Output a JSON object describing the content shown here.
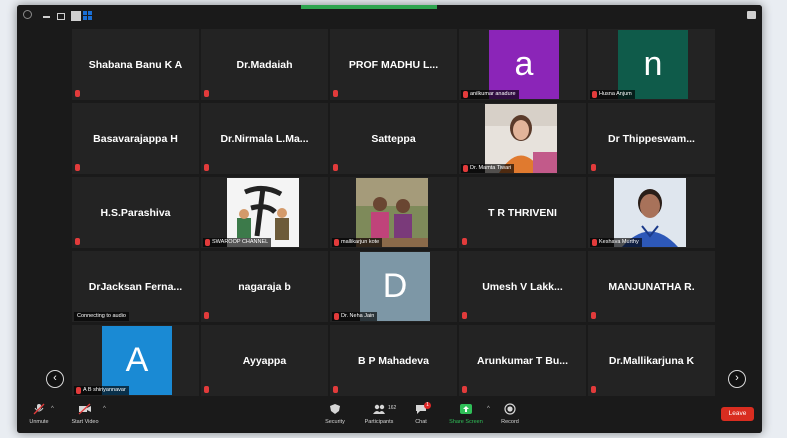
{
  "colors": {
    "window_bg": "#1a1a1a",
    "tile_bg": "#232323",
    "mic_muted": "#e23b3b",
    "active_speaker": "#2ea44f",
    "share_screen": "#2fbf58",
    "leave": "#d92d20",
    "avatar_a_purple": "#8b25b8",
    "avatar_n_green": "#0f5b4a",
    "avatar_D_grey": "#7d97a6",
    "avatar_A_blue": "#1a8ad4"
  },
  "tiles": [
    {
      "name": "Shabana Banu K A",
      "kind": "name"
    },
    {
      "name": "Dr.Madaiah",
      "kind": "name"
    },
    {
      "name": "PROF MADHU L...",
      "kind": "name"
    },
    {
      "name": "anilkumar anadure",
      "kind": "avatar",
      "letter": "a"
    },
    {
      "name": "Husna Anjum",
      "kind": "avatar",
      "letter": "n"
    },
    {
      "name": "Basavarajappa H",
      "kind": "name"
    },
    {
      "name": "Dr.Nirmala L.Ma...",
      "kind": "name"
    },
    {
      "name": "Satteppa",
      "kind": "name"
    },
    {
      "name": "Dr. Mamta Tiwari",
      "kind": "photo"
    },
    {
      "name": "Dr Thippeswam...",
      "kind": "name"
    },
    {
      "name": "H.S.Parashiva",
      "kind": "name"
    },
    {
      "name": "SWAROOP CHANNEL",
      "kind": "photo"
    },
    {
      "name": "mallikarjun kote",
      "kind": "photo"
    },
    {
      "name": "T R THRIVENI",
      "kind": "name"
    },
    {
      "name": "Keshava Murthy",
      "kind": "photo"
    },
    {
      "name": "DrJacksan Ferna...",
      "kind": "name",
      "status": "Connecting to audio"
    },
    {
      "name": "nagaraja b",
      "kind": "name"
    },
    {
      "name": "Dr. Neha Jain",
      "kind": "avatar",
      "letter": "D"
    },
    {
      "name": "Umesh V Lakk...",
      "kind": "name"
    },
    {
      "name": "MANJUNATHA R.",
      "kind": "name"
    },
    {
      "name": "A B shiriyannavar",
      "kind": "avatar",
      "letter": "A"
    },
    {
      "name": "Ayyappa",
      "kind": "name"
    },
    {
      "name": "B P Mahadeva",
      "kind": "name"
    },
    {
      "name": "Arunkumar T Bu...",
      "kind": "name"
    },
    {
      "name": "Dr.Mallikarjuna K",
      "kind": "name"
    }
  ],
  "toolbar": {
    "unmute": "Unmute",
    "start_video": "Start Video",
    "security": "Security",
    "participants": "Participants",
    "participants_count": "162",
    "chat": "Chat",
    "chat_badge": "1",
    "share_screen": "Share Screen",
    "record": "Record",
    "leave": "Leave"
  },
  "nav": {
    "prev": "‹",
    "next": "›"
  }
}
